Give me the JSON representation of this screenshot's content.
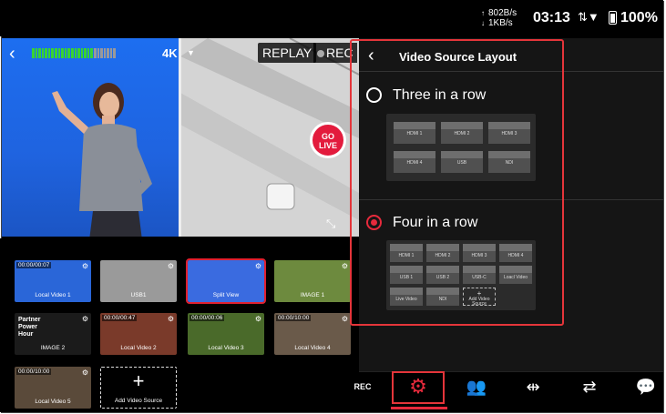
{
  "status_bar": {
    "upload_speed": "802B/s",
    "download_speed": "1KB/s",
    "time": "03:13",
    "battery_percent": "100%"
  },
  "preview": {
    "resolution": "4K",
    "replay_label": "REPLAY",
    "rec_label": "REC",
    "go_live_line1": "GO",
    "go_live_line2": "LIVE",
    "audio_level": 0.72
  },
  "sources": [
    {
      "label": "Local Video 1",
      "time": "00:00/00:07",
      "color": "#2a66d8"
    },
    {
      "label": "USB1",
      "time": "",
      "color": "#9a9a9a"
    },
    {
      "label": "Split View",
      "time": "",
      "color": "#3a6be0",
      "selected": true
    },
    {
      "label": "IMAGE 1",
      "time": "",
      "color": "#6d8a3e"
    },
    {
      "label": "IMAGE 2",
      "time": "",
      "color": "#1b1b1b"
    },
    {
      "label": "Local Video 2",
      "time": "00:00/00:47",
      "color": "#7a3a2a"
    },
    {
      "label": "Local Video 3",
      "time": "00:00/00:06",
      "color": "#4a6a2a"
    },
    {
      "label": "Local Video 4",
      "time": "00:00/10:00",
      "color": "#6a5a4a"
    },
    {
      "label": "Local Video 5",
      "time": "00:00/10:00",
      "color": "#5a4a3a"
    }
  ],
  "add_source_label": "Add Video Source",
  "image2_overlay": "Partner Power Hour",
  "panel": {
    "title": "Video Source Layout",
    "options": [
      {
        "label": "Three in a row",
        "selected": false,
        "cells": [
          "HDMI 1",
          "HDMI 2",
          "HDMI 3",
          "HDMI 4",
          "USB",
          "NDI"
        ]
      },
      {
        "label": "Four in a row",
        "selected": true,
        "cells": [
          "HDMI 1",
          "HDMI 2",
          "HDMI 3",
          "HDMI 4",
          "USB 1",
          "USB 2",
          "USB-C",
          "Loacl Video",
          "Live Video",
          "NDI",
          "Add Video Source"
        ]
      }
    ]
  },
  "toolbar": {
    "rec_label": "REC"
  },
  "colors": {
    "accent": "#e62a3c",
    "panel_bg": "#151515",
    "level_on": "#38d430"
  }
}
